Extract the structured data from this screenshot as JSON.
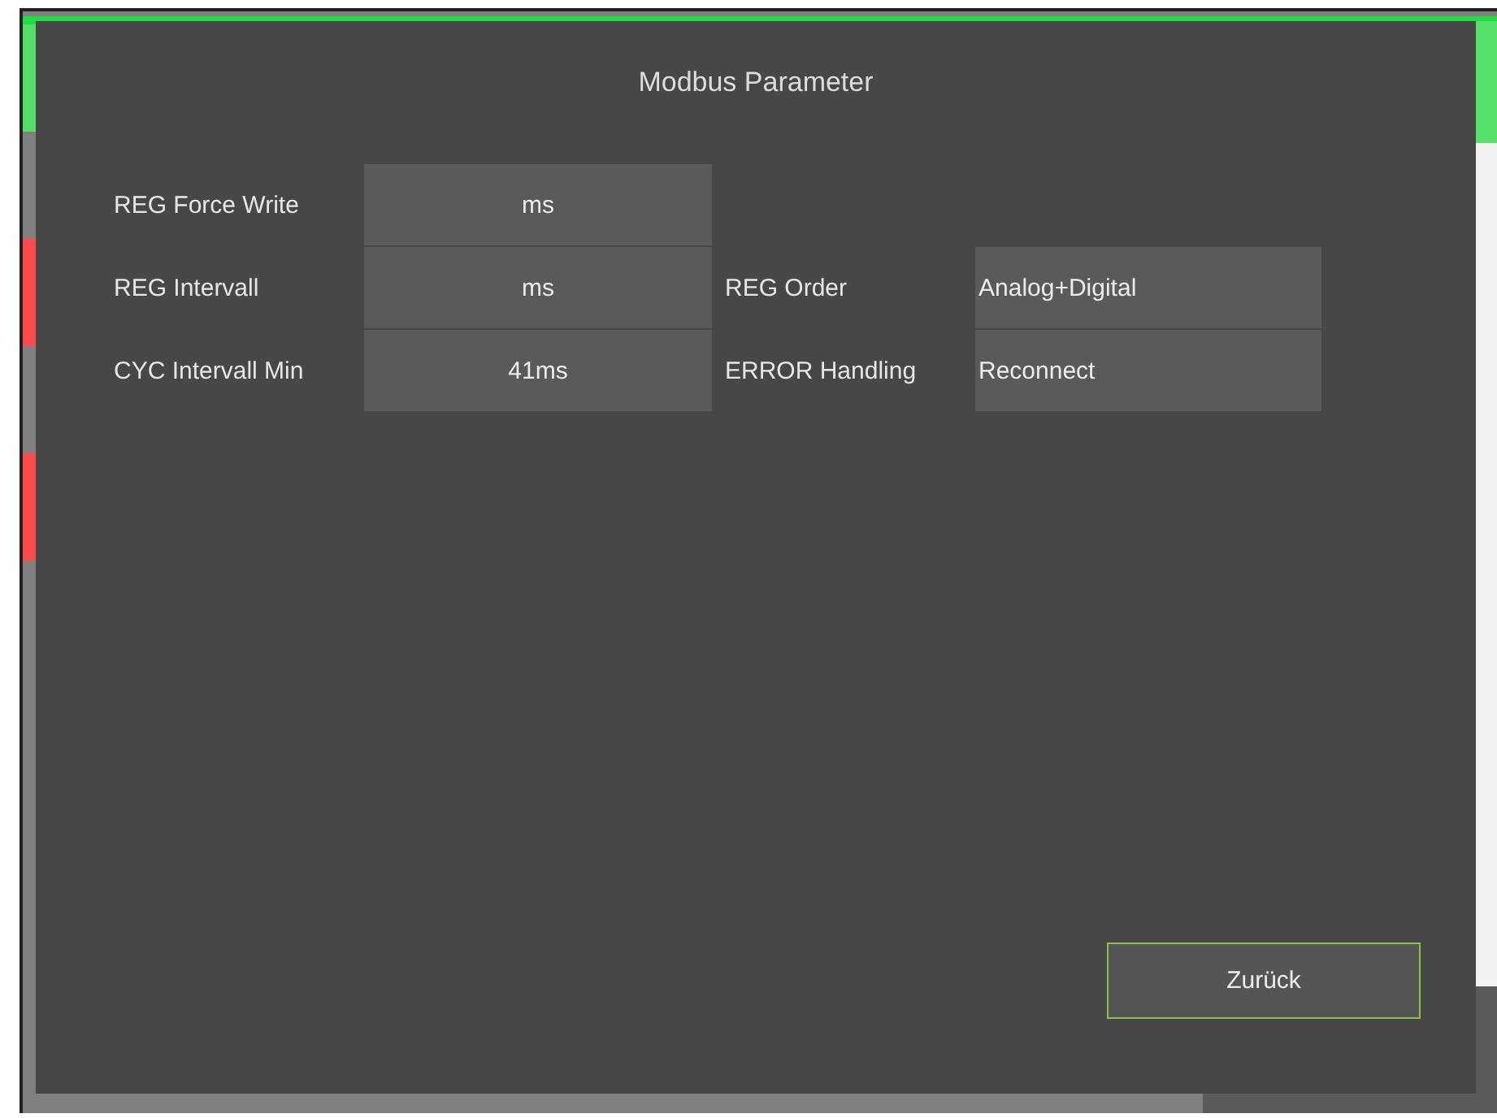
{
  "background": {
    "side_indicators": [
      {
        "color": "#52e06a"
      },
      {
        "color": "#ff4b4b"
      },
      {
        "color": "#ff4b4b"
      }
    ]
  },
  "dialog": {
    "title": "Modbus Parameter",
    "columns": [
      {
        "kind": "centered",
        "fields": [
          {
            "label": "REG Force Write",
            "value": "ms"
          },
          {
            "label": "REG Intervall",
            "value": "ms"
          },
          {
            "label": "CYC Intervall Min",
            "value": "41ms"
          }
        ]
      },
      {
        "kind": "plain",
        "fields": [
          {
            "label": "REG Order",
            "value": "Analog+Digital"
          },
          {
            "label": "ERROR Handling",
            "value": "Reconnect"
          }
        ]
      }
    ],
    "button": "Zurück"
  }
}
